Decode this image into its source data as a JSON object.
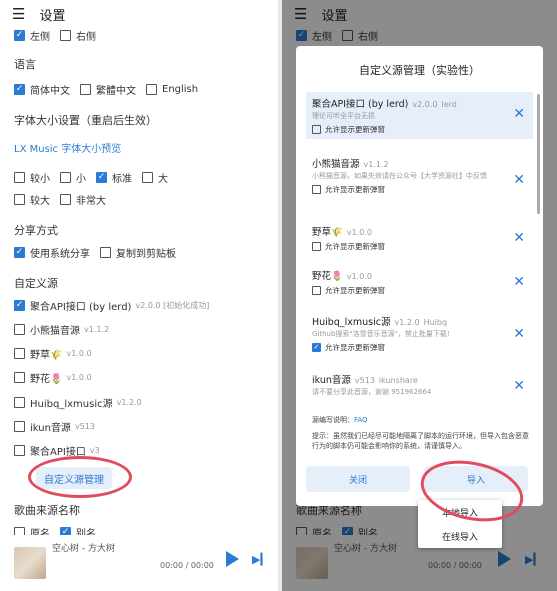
{
  "header": {
    "title": "设置",
    "menu_icon": "hamburger-icon"
  },
  "left": {
    "partial_top": [
      {
        "label": "左侧",
        "checked": true
      },
      {
        "label": "右侧",
        "checked": false
      }
    ],
    "language": {
      "title": "语言",
      "options": [
        {
          "label": "简体中文",
          "checked": true
        },
        {
          "label": "繁體中文",
          "checked": false
        },
        {
          "label": "English",
          "checked": false
        }
      ]
    },
    "font": {
      "title": "字体大小设置（重启后生效）",
      "preview": "LX Music 字体大小预览",
      "row1": [
        {
          "label": "较小",
          "checked": false
        },
        {
          "label": "小",
          "checked": false
        },
        {
          "label": "标准",
          "checked": true
        },
        {
          "label": "大",
          "checked": false
        }
      ],
      "row2": [
        {
          "label": "较大",
          "checked": false
        },
        {
          "label": "非常大",
          "checked": false
        }
      ]
    },
    "share": {
      "title": "分享方式",
      "options": [
        {
          "label": "使用系统分享",
          "checked": true
        },
        {
          "label": "复制到剪贴板",
          "checked": false
        }
      ]
    },
    "custom": {
      "title": "自定义源",
      "manage_label": "自定义源管理",
      "items": [
        {
          "label": "聚合API接口 (by lerd)",
          "meta": "v2.0.0 [初始化成功]",
          "checked": true
        },
        {
          "label": "小熊猫音源",
          "meta": "v1.1.2",
          "checked": false
        },
        {
          "label": "野草🌾",
          "meta": "v1.0.0",
          "checked": false
        },
        {
          "label": "野花🌷",
          "meta": "v1.0.0",
          "checked": false
        },
        {
          "label": "Huibq_lxmusic源",
          "meta": "v1.2.0",
          "checked": false
        },
        {
          "label": "ikun音源",
          "meta": "v513",
          "checked": false
        },
        {
          "label": "聚合API接口",
          "meta": "v3",
          "checked": false
        }
      ]
    },
    "song_source": {
      "title": "歌曲来源名称",
      "options": [
        {
          "label": "原名",
          "checked": false
        },
        {
          "label": "别名",
          "checked": true
        }
      ]
    }
  },
  "player": {
    "title": "空心树 - 方大树",
    "time": "00:00 / 00:00"
  },
  "dialog": {
    "title": "自定义源管理（实验性）",
    "allow_update_label": "允许显示更新弹窗",
    "sources": [
      {
        "name": "聚合API接口 (by lerd)",
        "version": "v2.0.0",
        "author": "lerd",
        "desc": "理论可听全平台无损",
        "allow": false,
        "selected": true
      },
      {
        "name": "小熊猫音源",
        "version": "v1.1.2",
        "author": "",
        "desc": "小熊猫音源，如果失效请在公众号【大学资源社】中反馈",
        "allow": false,
        "selected": false
      },
      {
        "name": "野草🌾",
        "version": "v1.0.0",
        "author": "",
        "desc": "",
        "allow": false,
        "selected": false
      },
      {
        "name": "野花🌷",
        "version": "v1.0.0",
        "author": "",
        "desc": "",
        "allow": false,
        "selected": false
      },
      {
        "name": "Huibq_lxmusic源",
        "version": "v1.2.0",
        "author": "Huibq",
        "desc": "Github搜索\"洛雪音乐音源\"，禁止批量下载!",
        "allow": true,
        "selected": false
      },
      {
        "name": "ikun音源",
        "version": "v513",
        "author": "ikunshare",
        "desc": "请不要分享此音源，谢谢 951962664",
        "allow": false,
        "selected": false
      }
    ],
    "doc_label": "源编写说明：",
    "doc_link": "FAQ",
    "warning": "提示：虽然我们已经尽可能地隔离了脚本的运行环境，但导入包含恶意行为的脚本仍可能会影响你的系统，请谨慎导入。",
    "close_label": "关闭",
    "import_label": "导入"
  },
  "import_menu": {
    "items": [
      "本地导入",
      "在线导入"
    ]
  },
  "colors": {
    "accent": "#2a7bd6",
    "annotation": "#e14b5e"
  }
}
